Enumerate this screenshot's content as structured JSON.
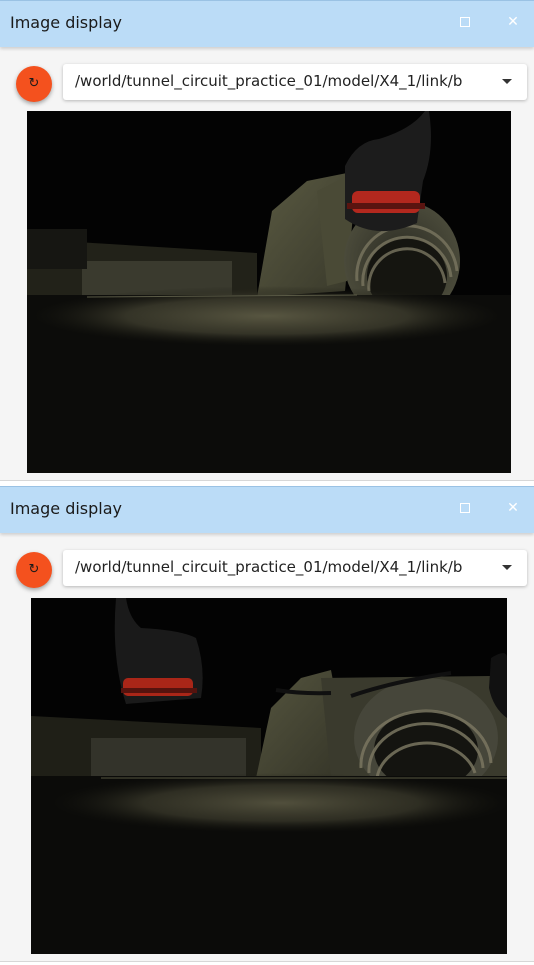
{
  "panels": [
    {
      "title": "Image display",
      "topic": "/world/tunnel_circuit_practice_01/model/X4_1/link/b",
      "refresh_icon": "refresh-icon",
      "maximize_icon": "maximize-icon",
      "close_icon": "close-icon"
    },
    {
      "title": "Image display",
      "topic": "/world/tunnel_circuit_practice_01/model/X4_1/link/b",
      "refresh_icon": "refresh-icon",
      "maximize_icon": "maximize-icon",
      "close_icon": "close-icon"
    }
  ],
  "colors": {
    "titlebar": "#bbdcf7",
    "refresh_button": "#f4511e",
    "panel_bg": "#f5f5f5"
  }
}
